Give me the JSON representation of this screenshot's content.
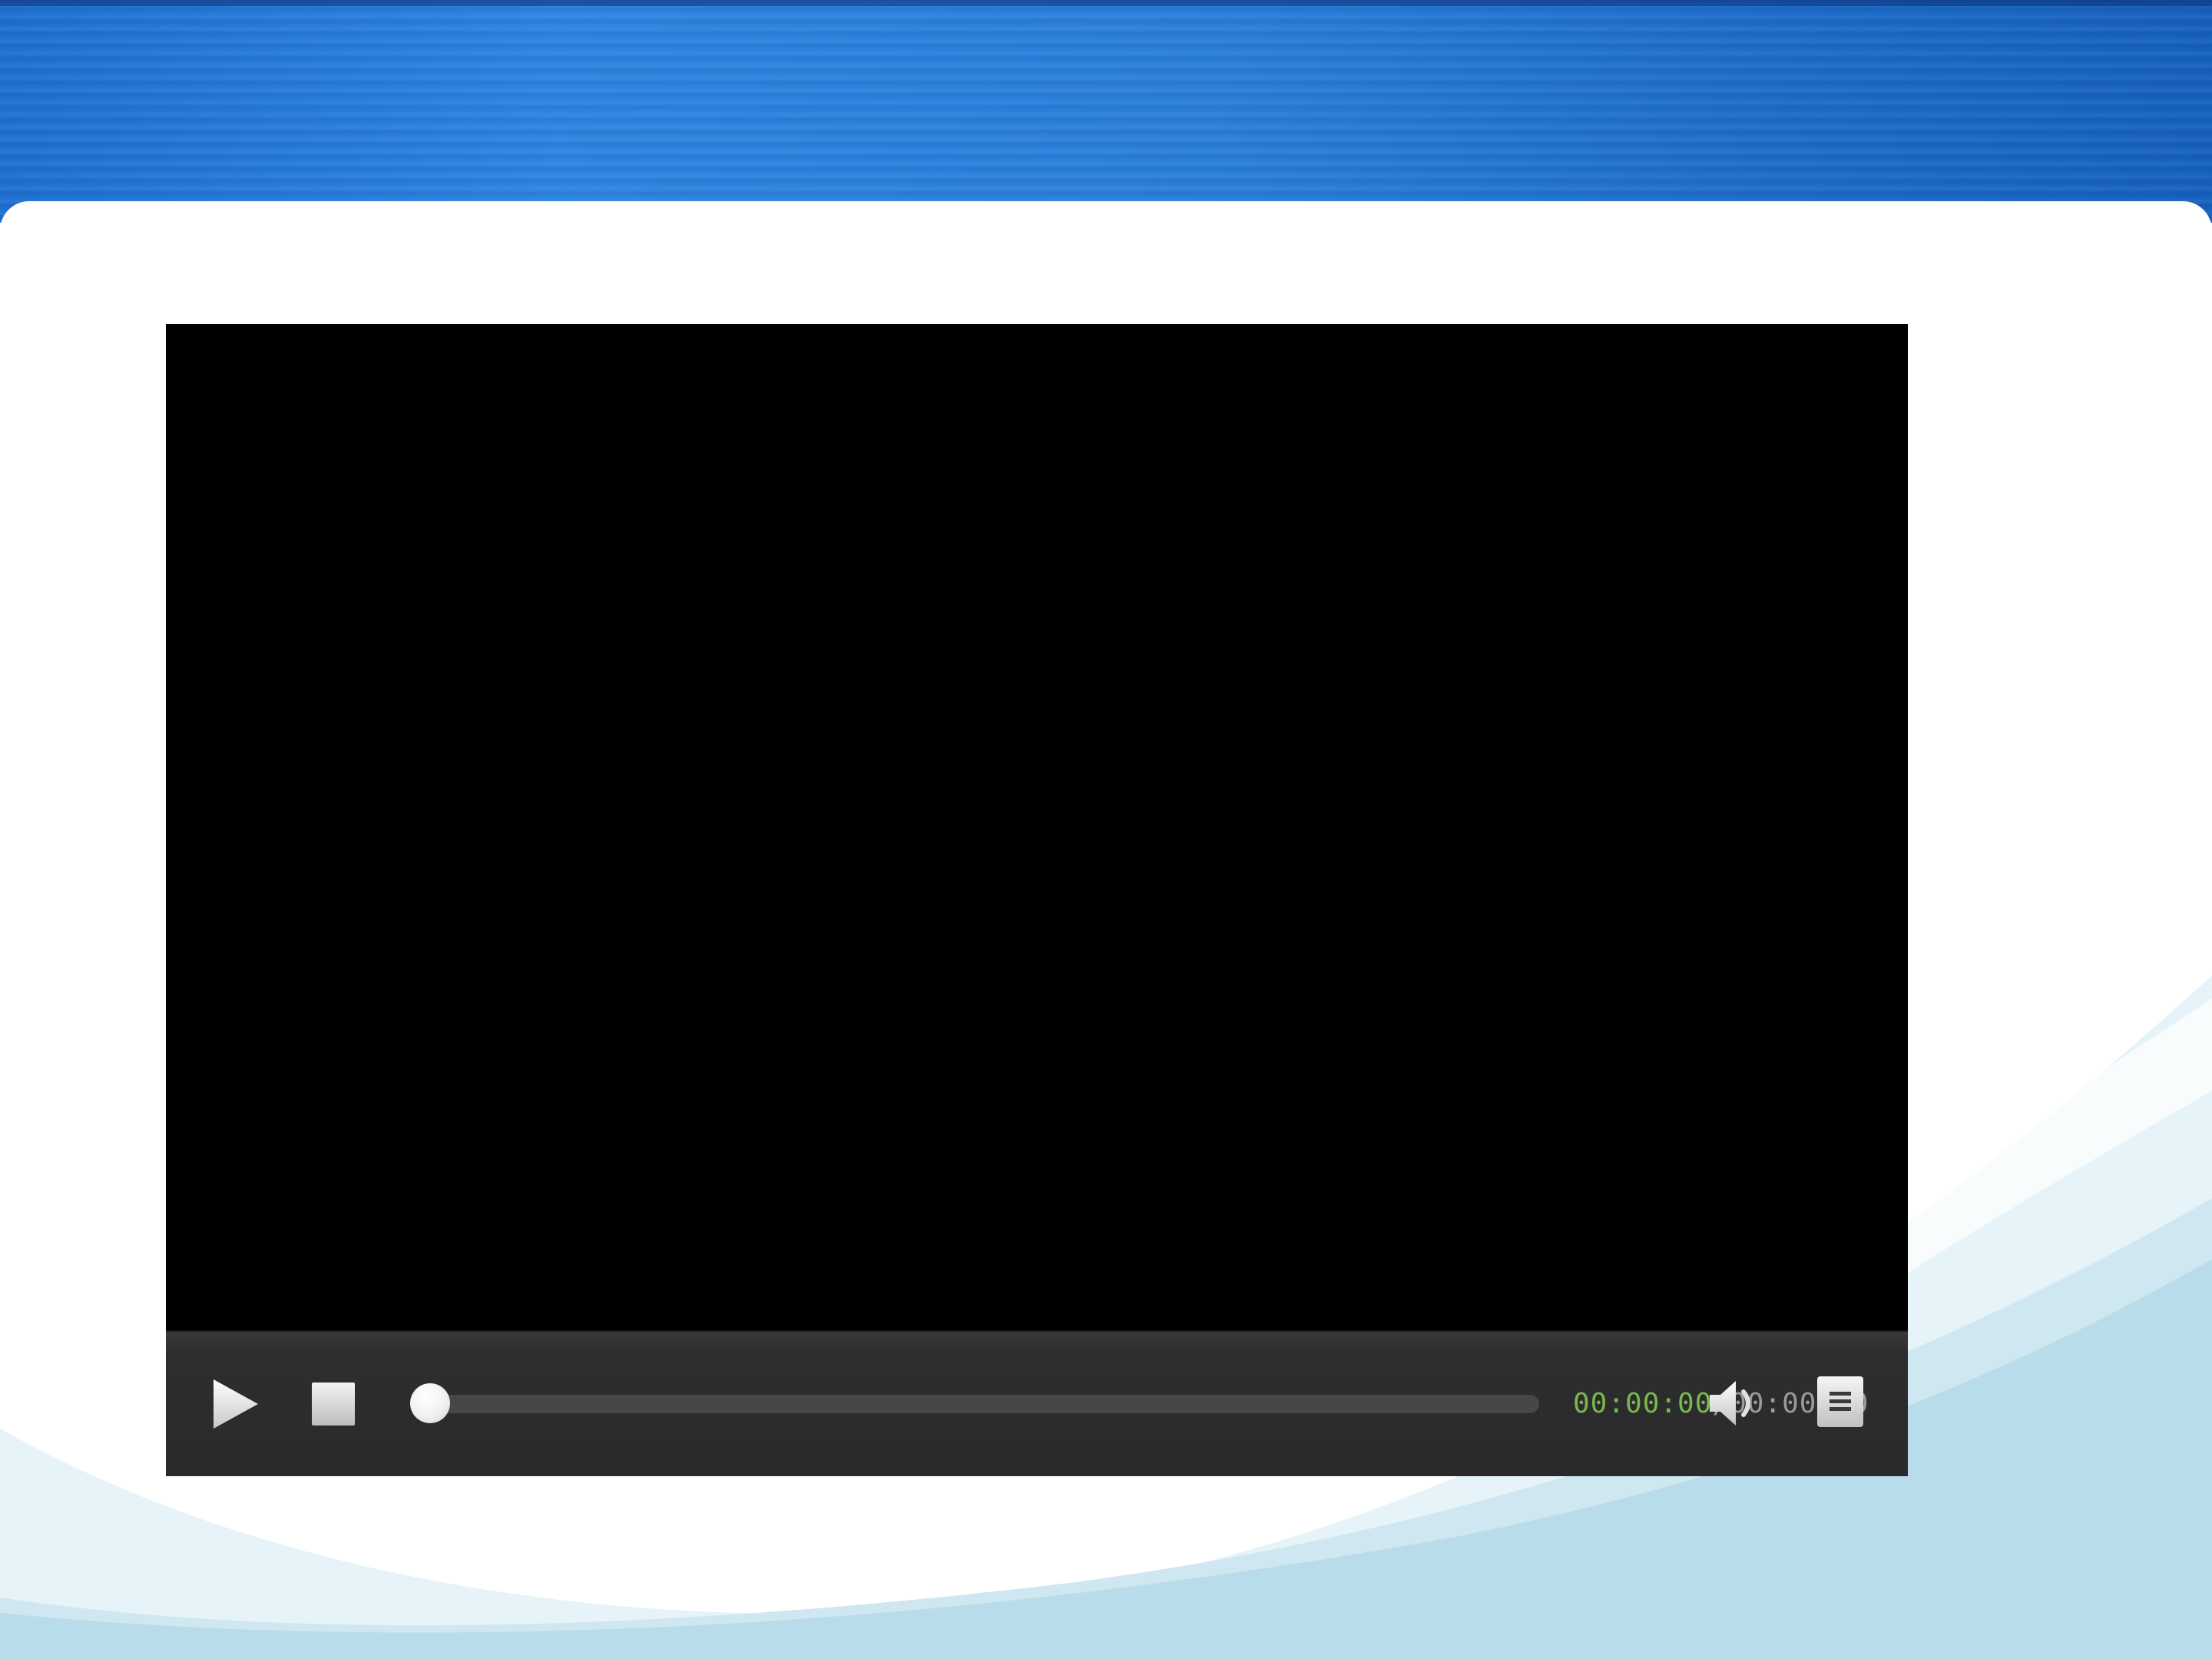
{
  "player": {
    "current_time": "00:00:00",
    "total_time": "/00:00:00",
    "progress": 0.0
  },
  "icons": {
    "play": "play-icon",
    "stop": "stop-icon",
    "volume": "volume-icon",
    "menu": "menu-icon"
  },
  "colors": {
    "banner_blue": "#2a7ed9",
    "current_time_green": "#79b84a",
    "total_time_gray": "#9a9a9c",
    "controls_bg": "#2c2c2e"
  }
}
